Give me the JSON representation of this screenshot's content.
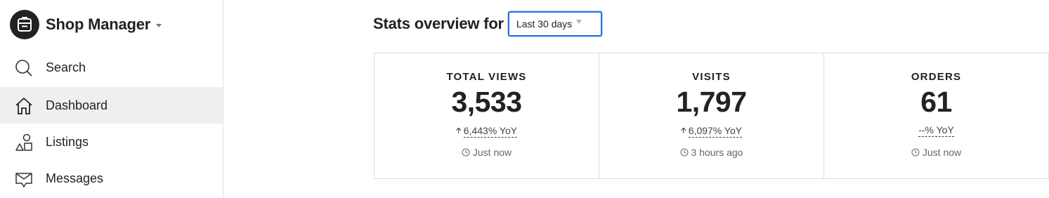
{
  "sidebar": {
    "brand": {
      "name": "Shop Manager"
    },
    "items": [
      {
        "label": "Search",
        "icon": "search-icon"
      },
      {
        "label": "Dashboard",
        "icon": "home-icon",
        "active": true
      },
      {
        "label": "Listings",
        "icon": "shapes-icon"
      },
      {
        "label": "Messages",
        "icon": "envelope-icon"
      }
    ]
  },
  "main": {
    "stats_title": "Stats overview for",
    "range_select": {
      "value": "Last 30 days"
    },
    "stats": [
      {
        "label": "TOTAL VIEWS",
        "value": "3,533",
        "change": "6,443% YoY",
        "updated": "Just now",
        "trend": "up"
      },
      {
        "label": "VISITS",
        "value": "1,797",
        "change": "6,097% YoY",
        "updated": "3 hours ago",
        "trend": "up"
      },
      {
        "label": "ORDERS",
        "value": "61",
        "change": "--% YoY",
        "updated": "Just now",
        "trend": "none"
      }
    ]
  },
  "colors": {
    "accent": "#2f6fdf",
    "text": "#222222",
    "active_bg": "#efefef"
  }
}
